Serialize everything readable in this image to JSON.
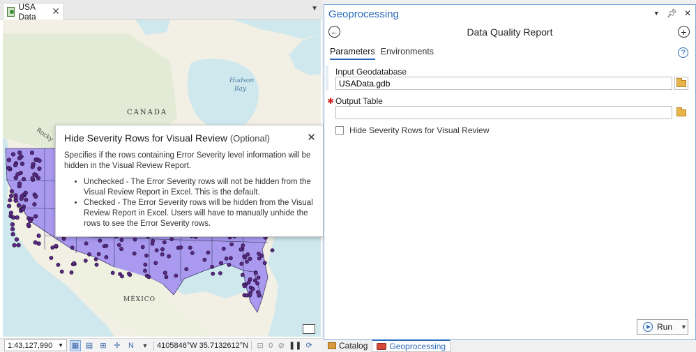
{
  "map_pane": {
    "tab_label": "USA Data",
    "labels": {
      "hudson_bay_1": "Hudson",
      "hudson_bay_2": "Bay",
      "canada": "CANADA",
      "mexico": "MÉXICO",
      "rocky": "Rocky"
    },
    "status": {
      "scale": "1:43,127,990",
      "coordinates": "4105846°W 35.7132612°N",
      "selection_count": "0"
    }
  },
  "popup": {
    "title": "Hide Severity Rows for Visual Review",
    "title_suffix": "(Optional)",
    "description": "Specifies if the rows containing Error Severity level information will be hidden in the Visual Review Report.",
    "bullets": [
      "Unchecked - The Error Severity rows will not be hidden from the Visual Review Report in Excel. This is the default.",
      "Checked - The Error Severity rows will be hidden from the Visual Review Report in Excel. Users will have to manually unhide the rows to see the Error Severity rows."
    ]
  },
  "geoprocessing": {
    "pane_title": "Geoprocessing",
    "tool_title": "Data Quality Report",
    "tabs": [
      "Parameters",
      "Environments"
    ],
    "params": {
      "input_gdb_label": "Input Geodatabase",
      "input_gdb_value": "USAData.gdb",
      "output_table_label": "Output Table",
      "output_table_value": "",
      "hide_rows_label": "Hide Severity Rows for Visual Review"
    },
    "run_label": "Run"
  },
  "bottom_tabs": [
    "Catalog",
    "Geoprocessing"
  ],
  "colors": {
    "accent": "#2a6ab8",
    "state_fill": "#a99af0",
    "point_fill": "#5a2a86"
  }
}
